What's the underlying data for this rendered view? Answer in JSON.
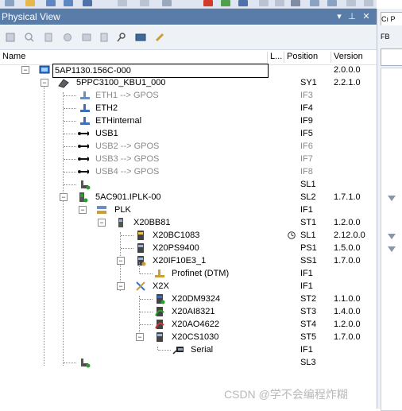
{
  "panel": {
    "title": "Physical View",
    "pin_icon": "pin-icon",
    "close_icon": "close-icon",
    "menu_icon": "dropdown-arrow-icon"
  },
  "columns": {
    "name": "Name",
    "l": "L...",
    "position": "Position",
    "version": "Version"
  },
  "rows": [
    {
      "label": "5AP1130.156C-000",
      "position": "",
      "version": "2.0.0.0",
      "gray": false,
      "icon": "panel-display-icon",
      "selected": true
    },
    {
      "label": "5PPC3100_KBU1_000",
      "position": "SY1",
      "version": "2.2.1.0",
      "gray": false,
      "icon": "pc-icon"
    },
    {
      "label": "ETH1 --> GPOS",
      "position": "IF3",
      "version": "",
      "gray": true,
      "icon": "ethernet-icon"
    },
    {
      "label": "ETH2",
      "position": "IF4",
      "version": "",
      "gray": false,
      "icon": "ethernet-icon"
    },
    {
      "label": "ETHinternal",
      "position": "IF9",
      "version": "",
      "gray": false,
      "icon": "ethernet-icon"
    },
    {
      "label": "USB1",
      "position": "IF5",
      "version": "",
      "gray": false,
      "icon": "usb-icon"
    },
    {
      "label": "USB2 --> GPOS",
      "position": "IF6",
      "version": "",
      "gray": true,
      "icon": "usb-icon"
    },
    {
      "label": "USB3 --> GPOS",
      "position": "IF7",
      "version": "",
      "gray": true,
      "icon": "usb-icon"
    },
    {
      "label": "USB4 --> GPOS",
      "position": "IF8",
      "version": "",
      "gray": true,
      "icon": "usb-icon"
    },
    {
      "label": "",
      "position": "SL1",
      "version": "",
      "gray": false,
      "icon": "empty-slot-icon"
    },
    {
      "label": "5AC901.IPLK-00",
      "position": "SL2",
      "version": "1.7.1.0",
      "gray": false,
      "icon": "card-icon"
    },
    {
      "label": "PLK",
      "position": "IF1",
      "version": "",
      "gray": false,
      "icon": "network-icon"
    },
    {
      "label": "X20BB81",
      "position": "ST1",
      "version": "1.2.0.0",
      "gray": false,
      "icon": "module-icon"
    },
    {
      "label": "X20BC1083",
      "position": "SL1",
      "version": "2.12.0.0",
      "gray": false,
      "icon": "module-icon",
      "status": "clock-icon"
    },
    {
      "label": "X20PS9400",
      "position": "PS1",
      "version": "1.5.0.0",
      "gray": false,
      "icon": "module-icon"
    },
    {
      "label": "X20IF10E3_1",
      "position": "SS1",
      "version": "1.7.0.0",
      "gray": false,
      "icon": "module-icon"
    },
    {
      "label": "Profinet (DTM)",
      "position": "IF1",
      "version": "",
      "gray": false,
      "icon": "network-icon"
    },
    {
      "label": "X2X",
      "position": "IF1",
      "version": "",
      "gray": false,
      "icon": "x2x-icon"
    },
    {
      "label": "X20DM9324",
      "position": "ST2",
      "version": "1.1.0.0",
      "gray": false,
      "icon": "module-icon"
    },
    {
      "label": "X20AI8321",
      "position": "ST3",
      "version": "1.4.0.0",
      "gray": false,
      "icon": "analog-module-icon"
    },
    {
      "label": "X20AO4622",
      "position": "ST4",
      "version": "1.2.0.0",
      "gray": false,
      "icon": "analog-module-icon"
    },
    {
      "label": "X20CS1030",
      "position": "ST5",
      "version": "1.7.0.0",
      "gray": false,
      "icon": "module-icon"
    },
    {
      "label": "Serial",
      "position": "IF1",
      "version": "",
      "gray": false,
      "icon": "serial-icon"
    },
    {
      "label": "",
      "position": "SL3",
      "version": "",
      "gray": false,
      "icon": "empty-slot-icon"
    }
  ],
  "right_panel": {
    "tab_label": "Cı P",
    "toolbar_label": "FB"
  },
  "watermark": "CSDN @学不会编程炸糊",
  "colors": {
    "title_bar": "#5a7ca8",
    "panel_bg": "#eef1f6",
    "gray_text": "#8a8a8a"
  }
}
